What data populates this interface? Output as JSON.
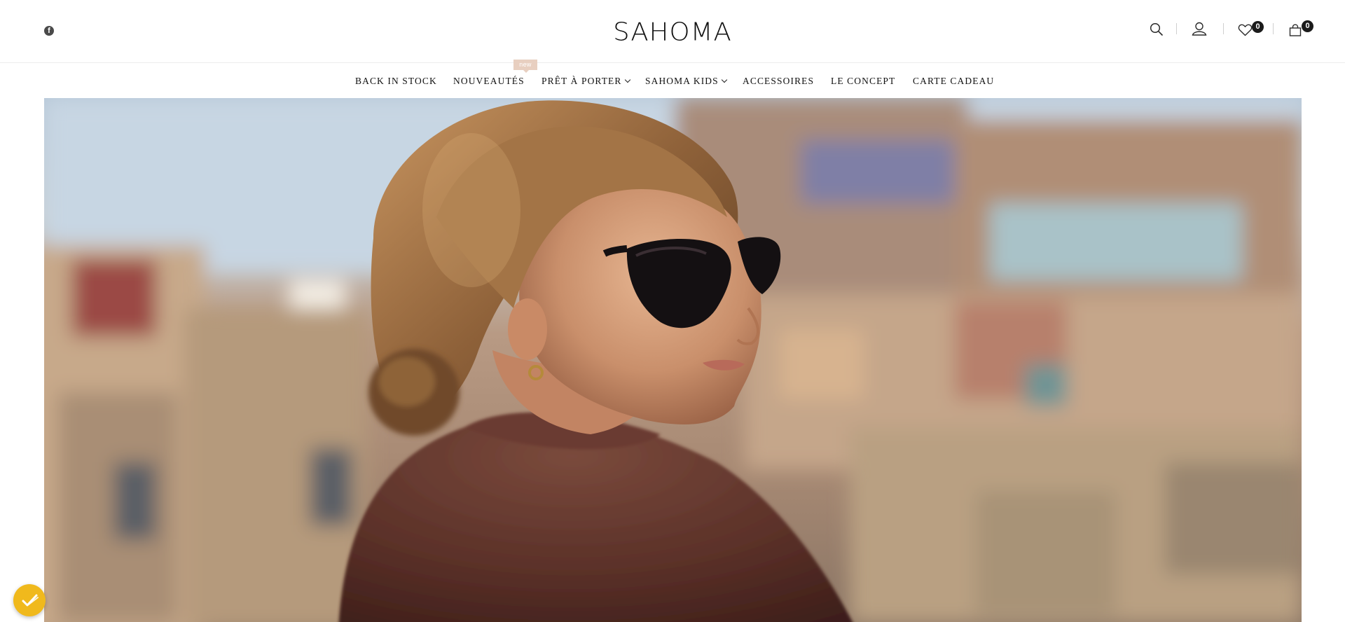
{
  "header": {
    "brand": "SAHOMA",
    "wishlist_count": "0",
    "cart_count": "0"
  },
  "icons": {
    "social": "facebook-icon",
    "search": "search-icon",
    "account": "user-icon",
    "wishlist": "heart-icon",
    "cart": "shopping-bag-icon",
    "cookie": "cookie-consent-icon"
  },
  "nav": {
    "items": [
      {
        "label": "BACK IN STOCK"
      },
      {
        "label": "NOUVEAUTÉS",
        "badge": "new"
      },
      {
        "label": "PRÊT À PORTER"
      },
      {
        "label": "SAHOMA KIDS"
      },
      {
        "label": "ACCESSOIRES"
      },
      {
        "label": "LE CONCEPT"
      },
      {
        "label": "CARTE CADEAU"
      }
    ]
  },
  "colors": {
    "badge": "#e8cfc0",
    "counter": "#1b1b1b",
    "cookie_button": "#f0b91c"
  }
}
